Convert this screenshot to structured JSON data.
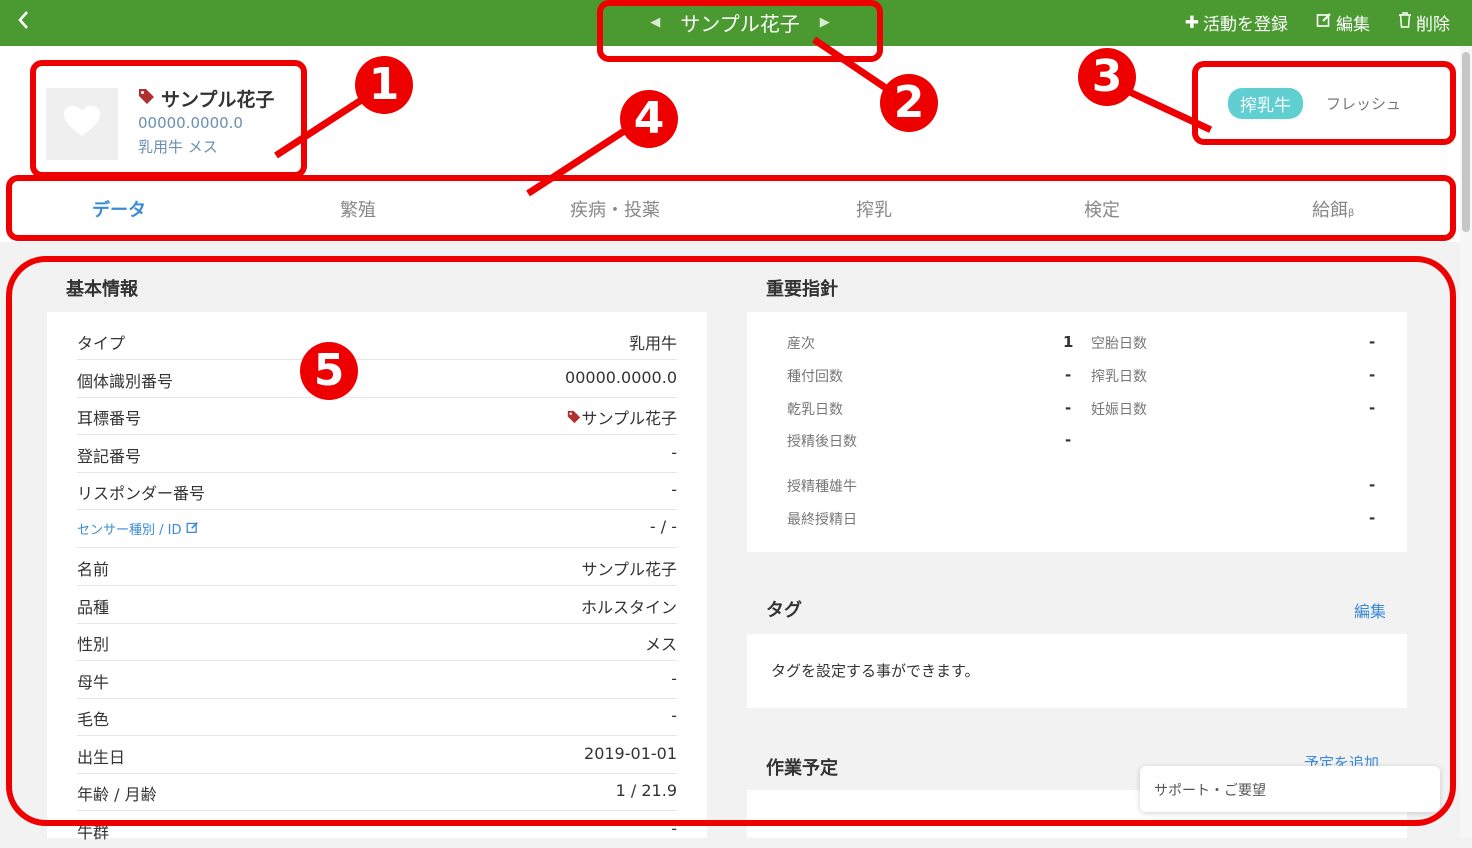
{
  "topbar": {
    "back_icon": "chevron-left-icon",
    "title": "サンプル花子",
    "actions": [
      {
        "icon": "plus-icon",
        "label": "活動を登録"
      },
      {
        "icon": "edit-icon",
        "label": "編集"
      },
      {
        "icon": "trash-icon",
        "label": "削除"
      }
    ]
  },
  "profile": {
    "name": "サンプル花子",
    "id": "00000.0000.0",
    "type": "乳用牛 メス",
    "badge": "搾乳牛",
    "status": "フレッシュ"
  },
  "tabs": [
    {
      "label": "データ",
      "active": true
    },
    {
      "label": "繁殖",
      "active": false
    },
    {
      "label": "疾病・投薬",
      "active": false
    },
    {
      "label": "搾乳",
      "active": false
    },
    {
      "label": "検定",
      "active": false
    },
    {
      "label": "給餌",
      "suffix": "β",
      "active": false
    }
  ],
  "basic_info": {
    "title": "基本情報",
    "rows": [
      {
        "label": "タイプ",
        "value": "乳用牛"
      },
      {
        "label": "個体識別番号",
        "value": "00000.0000.0"
      },
      {
        "label": "耳標番号",
        "value": "サンプル花子"
      },
      {
        "label": "登記番号",
        "value": "-"
      },
      {
        "label": "リスポンダー番号",
        "value": "-"
      },
      {
        "label": "センサー種別 / ID",
        "value": "- / -"
      },
      {
        "label": "名前",
        "value": "サンプル花子"
      },
      {
        "label": "品種",
        "value": "ホルスタイン"
      },
      {
        "label": "性別",
        "value": "メス"
      },
      {
        "label": "母牛",
        "value": "-"
      },
      {
        "label": "毛色",
        "value": "-"
      },
      {
        "label": "出生日",
        "value": "2019-01-01"
      },
      {
        "label": "年齢 / 月齢",
        "value": "1 / 21.9"
      },
      {
        "label": "牛群",
        "value": "-"
      }
    ]
  },
  "key_metrics": {
    "title": "重要指針",
    "left": [
      {
        "label": "産次",
        "value": "1"
      },
      {
        "label": "種付回数",
        "value": "-"
      },
      {
        "label": "乾乳日数",
        "value": "-"
      },
      {
        "label": "授精後日数",
        "value": "-"
      }
    ],
    "right": [
      {
        "label": "空胎日数",
        "value": "-"
      },
      {
        "label": "搾乳日数",
        "value": "-"
      },
      {
        "label": "妊娠日数",
        "value": "-"
      }
    ],
    "bottom": [
      {
        "label": "授精種雄牛",
        "value": "-"
      },
      {
        "label": "最終授精日",
        "value": "-"
      }
    ]
  },
  "tags": {
    "title": "タグ",
    "edit_label": "編集",
    "body": "タグを設定する事ができます。"
  },
  "schedule": {
    "title": "作業予定",
    "add_label": "予定を追加"
  },
  "support": {
    "label": "サポート・ご要望"
  },
  "annotations": [
    "1",
    "2",
    "3",
    "4",
    "5"
  ],
  "colors": {
    "topbar": "#4a9a31",
    "accent": "#3a8ad8",
    "badge": "#5fcfd2",
    "annotation": "#ee0000"
  }
}
